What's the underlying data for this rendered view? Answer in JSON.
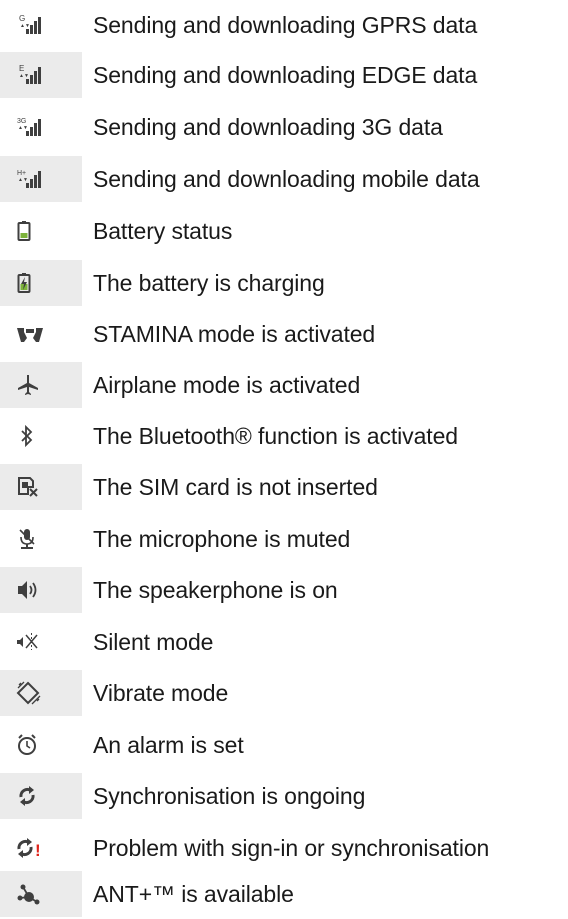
{
  "rows": [
    {
      "icon": "gprs-data-icon",
      "text": "Sending and downloading GPRS data",
      "shaded": false
    },
    {
      "icon": "edge-data-icon",
      "text": "Sending and downloading EDGE data",
      "shaded": true
    },
    {
      "icon": "3g-data-icon",
      "text": "Sending and downloading 3G data",
      "shaded": false
    },
    {
      "icon": "mobile-data-icon",
      "text": "Sending and downloading mobile data",
      "shaded": true
    },
    {
      "icon": "battery-icon",
      "text": "Battery status",
      "shaded": false
    },
    {
      "icon": "battery-charging-icon",
      "text": "The battery is charging",
      "shaded": true
    },
    {
      "icon": "stamina-icon",
      "text": "STAMINA mode is activated",
      "shaded": false
    },
    {
      "icon": "airplane-icon",
      "text": "Airplane mode is activated",
      "shaded": true
    },
    {
      "icon": "bluetooth-icon",
      "text": "The Bluetooth® function is activated",
      "shaded": false
    },
    {
      "icon": "no-sim-icon",
      "text": "The SIM card is not inserted",
      "shaded": true
    },
    {
      "icon": "mic-muted-icon",
      "text": "The microphone is muted",
      "shaded": false
    },
    {
      "icon": "speakerphone-icon",
      "text": "The speakerphone is on",
      "shaded": true
    },
    {
      "icon": "silent-mode-icon",
      "text": "Silent mode",
      "shaded": false
    },
    {
      "icon": "vibrate-icon",
      "text": "Vibrate mode",
      "shaded": true
    },
    {
      "icon": "alarm-icon",
      "text": "An alarm is set",
      "shaded": false
    },
    {
      "icon": "sync-icon",
      "text": "Synchronisation is ongoing",
      "shaded": true
    },
    {
      "icon": "sync-problem-icon",
      "text": "Problem with sign-in or synchronisation",
      "shaded": false
    },
    {
      "icon": "ant-plus-icon",
      "text": "ANT+™ is available",
      "shaded": true
    }
  ],
  "icon_labels": {
    "gprs": "G",
    "edge": "E",
    "threeg": "3G",
    "hplus": "H+",
    "problem_mark": "!"
  },
  "colors": {
    "icon": "#3f3f3f",
    "battery_fill": "#7db33b",
    "warning": "#e0241b",
    "shade": "#ebebeb"
  }
}
